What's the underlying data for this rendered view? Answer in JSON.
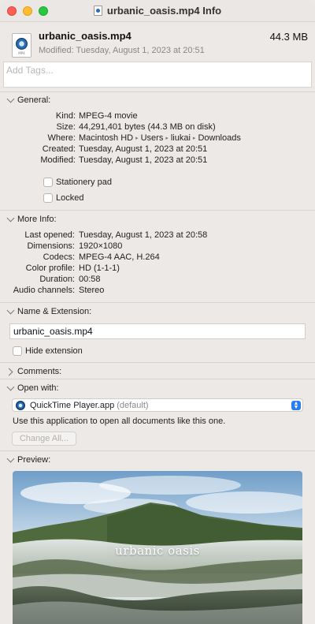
{
  "window": {
    "title": "urbanic_oasis.mp4 Info"
  },
  "header": {
    "file_name": "urbanic_oasis.mp4",
    "file_size": "44.3 MB",
    "modified": "Modified: Tuesday, August 1, 2023 at 20:51",
    "file_icon": "quicktime-movie-icon"
  },
  "tags": {
    "placeholder": "Add Tags..."
  },
  "general": {
    "label": "General:",
    "rows": [
      {
        "key": "Kind:",
        "value": "MPEG-4 movie"
      },
      {
        "key": "Size:",
        "value": "44,291,401 bytes (44.3 MB on disk)"
      },
      {
        "key": "Where:",
        "value_parts": [
          "Macintosh HD",
          "Users",
          "liukai",
          "Downloads"
        ]
      },
      {
        "key": "Created:",
        "value": "Tuesday, August 1, 2023 at 20:51"
      },
      {
        "key": "Modified:",
        "value": "Tuesday, August 1, 2023 at 20:51"
      }
    ],
    "stationery_label": "Stationery pad",
    "stationery_checked": false,
    "locked_label": "Locked",
    "locked_checked": false
  },
  "more_info": {
    "label": "More Info:",
    "rows": [
      {
        "key": "Last opened:",
        "value": "Tuesday, August 1, 2023 at 20:58"
      },
      {
        "key": "Dimensions:",
        "value": "1920×1080"
      },
      {
        "key": "Codecs:",
        "value": "MPEG-4 AAC, H.264"
      },
      {
        "key": "Color profile:",
        "value": "HD (1-1-1)"
      },
      {
        "key": "Duration:",
        "value": "00:58"
      },
      {
        "key": "Audio channels:",
        "value": "Stereo"
      }
    ]
  },
  "name_extension": {
    "label": "Name & Extension:",
    "value": "urbanic_oasis.mp4",
    "hide_extension_label": "Hide extension",
    "hide_extension_checked": false
  },
  "comments": {
    "label": "Comments:"
  },
  "open_with": {
    "label": "Open with:",
    "app": "QuickTime Player.app",
    "app_default": "(default)",
    "use_text": "Use this application to open all documents like this one.",
    "change_all": "Change All..."
  },
  "preview": {
    "label": "Preview:",
    "caption": "urbanic oasis"
  },
  "colors": {
    "window_bg": "#ece9e6",
    "close": "#ff5f57",
    "minimize": "#febc2e",
    "maximize": "#28c840",
    "accent": "#2b7bf4"
  }
}
